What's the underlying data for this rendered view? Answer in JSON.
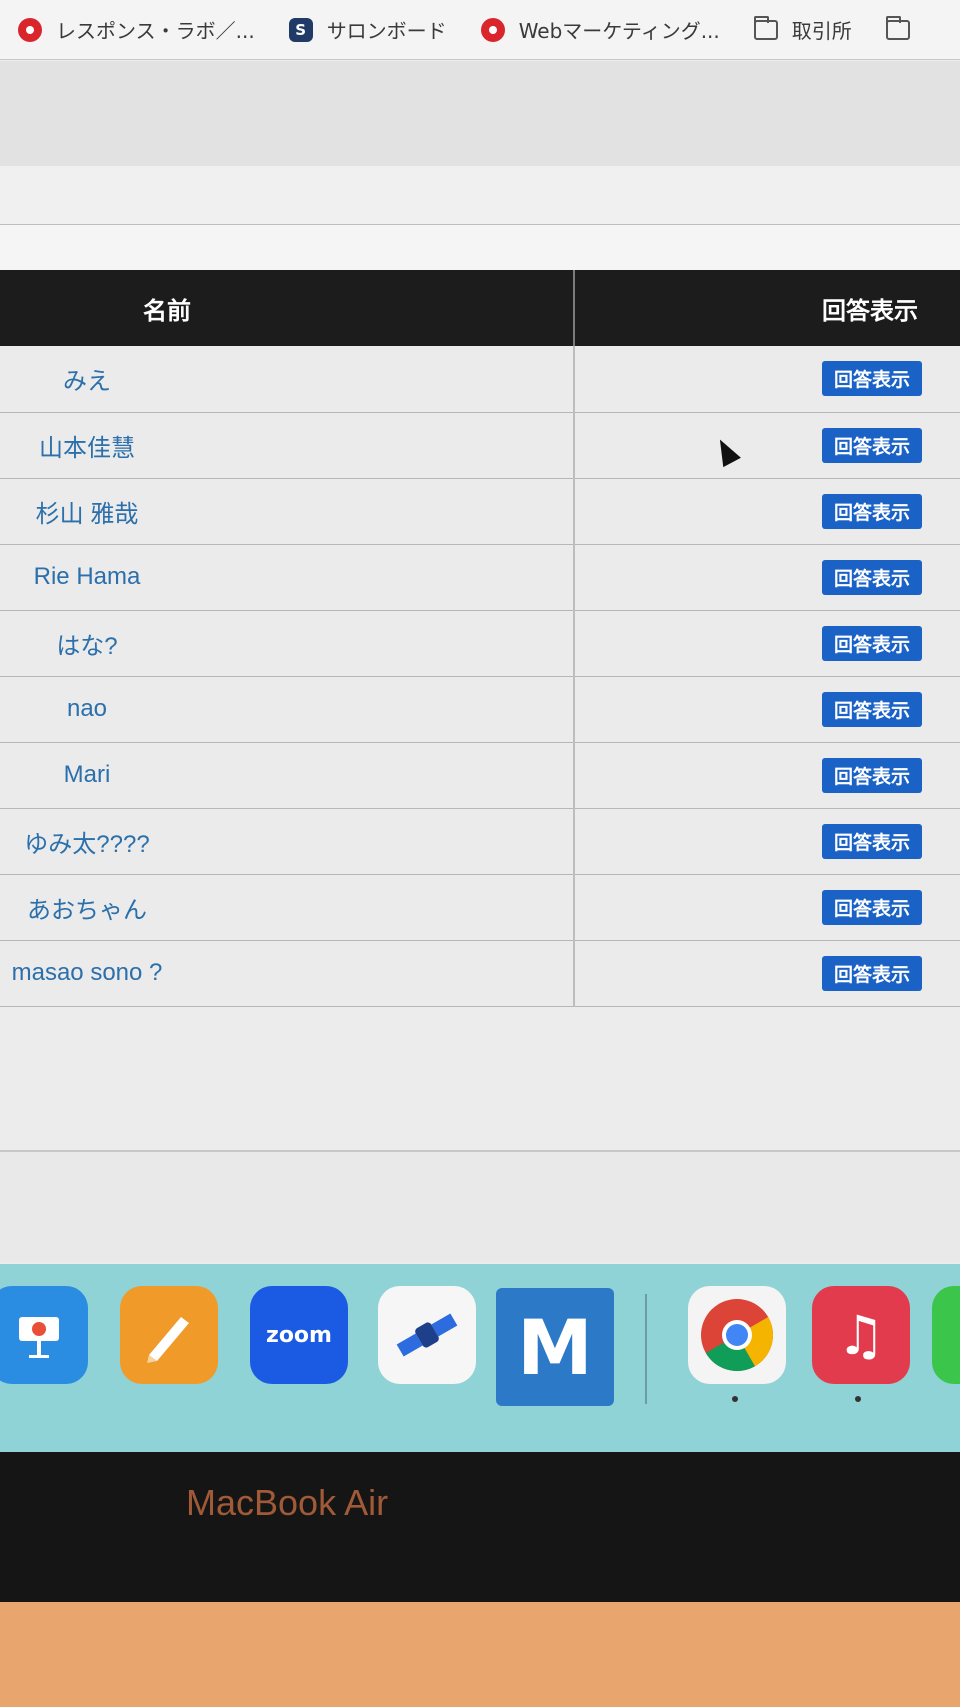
{
  "bookmarks": [
    {
      "label": "レスポンス・ラボ／...",
      "icon": "red-circle-icon"
    },
    {
      "label": "サロンボード",
      "icon": "s-badge-icon"
    },
    {
      "label": "Webマーケティング...",
      "icon": "red-circle-icon"
    },
    {
      "label": "取引所",
      "icon": "folder-icon"
    }
  ],
  "table": {
    "header_name": "名前",
    "header_view": "回答表示",
    "view_button_label": "回答表示",
    "rows": [
      {
        "name": "みえ"
      },
      {
        "name": "山本佳慧"
      },
      {
        "name": "杉山 雅哉"
      },
      {
        "name": "Rie Hama"
      },
      {
        "name": "はな?"
      },
      {
        "name": "nao"
      },
      {
        "name": "Mari"
      },
      {
        "name": "ゆみ太????"
      },
      {
        "name": "あおちゃん"
      },
      {
        "name": "masao sono ?"
      }
    ]
  },
  "dock": {
    "apps": [
      {
        "icon": "keynote-icon"
      },
      {
        "icon": "pages-icon"
      },
      {
        "icon": "zoom-icon",
        "label": "zoom"
      },
      {
        "icon": "satellite-app-icon"
      },
      {
        "icon": "m-bird-app-icon",
        "label": "M"
      },
      {
        "icon": "chrome-icon"
      },
      {
        "icon": "music-icon",
        "label": "♫"
      },
      {
        "icon": "messages-icon"
      }
    ]
  },
  "device_label": "MacBook Air",
  "colors": {
    "header_bg": "#1c1c1c",
    "name_link": "#2b6fab",
    "button_bg": "#1b62c7",
    "dock_bg": "#8fd3d6"
  }
}
